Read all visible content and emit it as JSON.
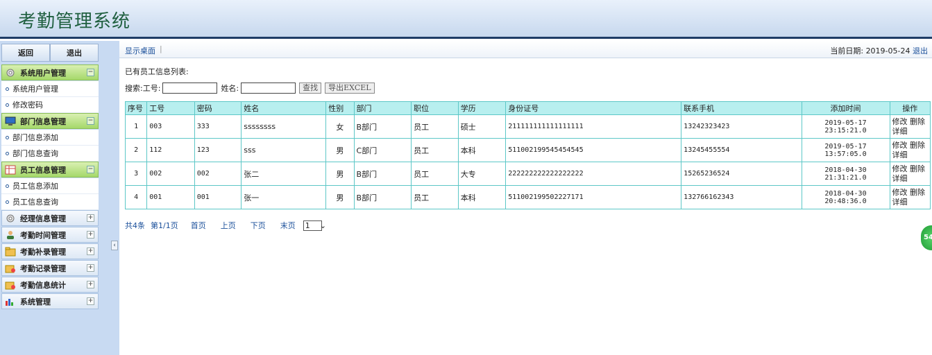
{
  "header": {
    "title": "考勤管理系统"
  },
  "sidebar": {
    "back": "返回",
    "logout": "退出",
    "groups": [
      {
        "label": "系统用户管理",
        "icon": "gear-icon",
        "open": true,
        "items": [
          "系统用户管理",
          "修改密码"
        ]
      },
      {
        "label": "部门信息管理",
        "icon": "monitor-icon",
        "open": true,
        "items": [
          "部门信息添加",
          "部门信息查询"
        ]
      },
      {
        "label": "员工信息管理",
        "icon": "table-icon",
        "open": true,
        "items": [
          "员工信息添加",
          "员工信息查询"
        ]
      },
      {
        "label": "经理信息管理",
        "icon": "gear-icon",
        "open": false
      },
      {
        "label": "考勤时间管理",
        "icon": "user-icon",
        "open": false
      },
      {
        "label": "考勤补录管理",
        "icon": "folder-icon",
        "open": false
      },
      {
        "label": "考勤记录管理",
        "icon": "folder-lock-icon",
        "open": false
      },
      {
        "label": "考勤信息统计",
        "icon": "folder-lock-icon",
        "open": false
      },
      {
        "label": "系统管理",
        "icon": "chart-icon",
        "open": false
      }
    ]
  },
  "crumb": {
    "home": "显示桌面",
    "date_label": "当前日期:",
    "date": "2019-05-24",
    "logout": "退出"
  },
  "main": {
    "list_title": "已有员工信息列表:",
    "search": {
      "label": "搜索:",
      "id_label": "工号:",
      "name_label": "姓名:",
      "find_btn": "查找",
      "export_btn": "导出EXCEL"
    },
    "table": {
      "headers": [
        "序号",
        "工号",
        "密码",
        "姓名",
        "性别",
        "部门",
        "职位",
        "学历",
        "身份证号",
        "联系手机",
        "添加时间",
        "操作"
      ],
      "rows": [
        [
          "1",
          "003",
          "333",
          "ssssssss",
          "女",
          "B部门",
          "员工",
          "硕士",
          "211111111111111111",
          "13242323423",
          "2019-05-17 23:15:21.0"
        ],
        [
          "2",
          "112",
          "123",
          "sss",
          "男",
          "C部门",
          "员工",
          "本科",
          "511002199545454545",
          "13245455554",
          "2019-05-17 13:57:05.0"
        ],
        [
          "3",
          "002",
          "002",
          "张二",
          "男",
          "B部门",
          "员工",
          "大专",
          "222222222222222222",
          "15265236524",
          "2018-04-30 21:31:21.0"
        ],
        [
          "4",
          "001",
          "001",
          "张一",
          "男",
          "B部门",
          "员工",
          "本科",
          "511002199502227171",
          "132766162343",
          "2018-04-30 20:48:36.0"
        ]
      ],
      "ops": {
        "edit": "修改",
        "delete": "删除",
        "detail": "详细"
      }
    },
    "pager": {
      "total": "共4条",
      "page": "第1/1页",
      "first": "首页",
      "prev": "上页",
      "next": "下页",
      "last": "末页",
      "selected": "1"
    }
  },
  "bubble": {
    "text": "54"
  }
}
